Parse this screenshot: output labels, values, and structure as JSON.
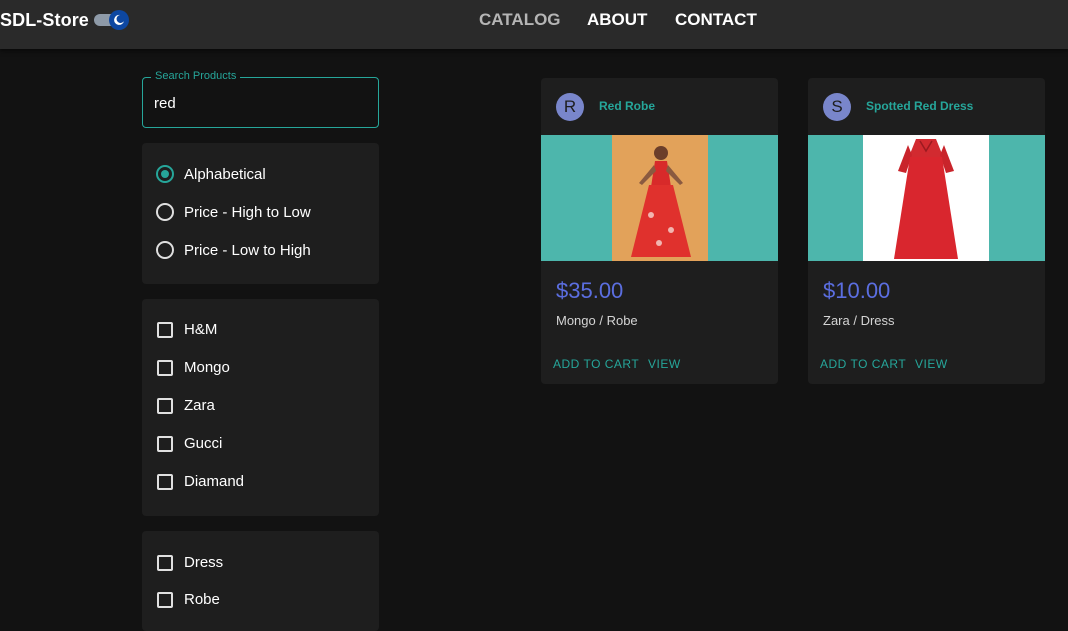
{
  "header": {
    "brand": "SDL-Store",
    "nav": [
      "CATALOG",
      "ABOUT",
      "CONTACT"
    ]
  },
  "search": {
    "label": "Search Products",
    "value": "red"
  },
  "sort": {
    "options": [
      "Alphabetical",
      "Price - High to Low",
      "Price - Low to High"
    ],
    "selected": "Alphabetical"
  },
  "brands": {
    "options": [
      "H&M",
      "Mongo",
      "Zara",
      "Gucci",
      "Diamand"
    ]
  },
  "types": {
    "options": [
      "Dress",
      "Robe"
    ]
  },
  "products": [
    {
      "initial": "R",
      "title": "Red Robe",
      "price": "$35.00",
      "meta": "Mongo / Robe",
      "add_label": "ADD TO CART",
      "view_label": "VIEW"
    },
    {
      "initial": "S",
      "title": "Spotted Red Dress",
      "price": "$10.00",
      "meta": "Zara / Dress",
      "add_label": "ADD TO CART",
      "view_label": "VIEW"
    }
  ],
  "colors": {
    "accent": "#26a69a",
    "price": "#5b6ee0",
    "avatar": "#7986cb",
    "media_bg": "#4db6ac"
  }
}
